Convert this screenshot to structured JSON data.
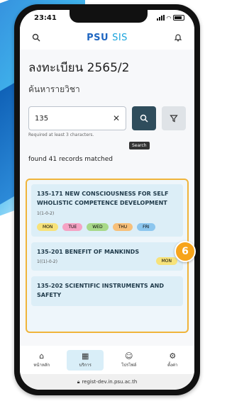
{
  "status": {
    "time": "23:41"
  },
  "header": {
    "logo_main": "PSU",
    "logo_sub": "SIS"
  },
  "page": {
    "title": "ลงทะเบียน 2565/2",
    "subtitle": "ค้นหารายวิชา"
  },
  "search": {
    "value": "135",
    "hint": "Required at least 3 characters.",
    "tooltip": "Search"
  },
  "results": {
    "found_text": "found 41 records matched",
    "items": [
      {
        "title": "135-171 NEW CONSCIOUSNESS FOR SELF WHOLISTIC COMPETENCE DEVELOPMENT",
        "credit": "1(1-0-2)",
        "days": [
          "MON",
          "TUE",
          "WED",
          "THU",
          "FRI"
        ]
      },
      {
        "title": "135-201 BENEFIT OF MANKINDS",
        "credit": "1((1)-0-2)",
        "days": [
          "MON"
        ]
      },
      {
        "title": "135-202 SCIENTIFIC INSTRUMENTS AND SAFETY",
        "credit": "",
        "days": []
      }
    ]
  },
  "annotation": {
    "badge": "6"
  },
  "nav": {
    "items": [
      {
        "label": "หน้าหลัก",
        "icon": "home-icon"
      },
      {
        "label": "บริการ",
        "icon": "grid-icon"
      },
      {
        "label": "โปรไฟล์",
        "icon": "profile-icon"
      },
      {
        "label": "ตั้งค่า",
        "icon": "gear-icon"
      }
    ]
  },
  "browser": {
    "url": "regist-dev.in.psu.ac.th"
  },
  "colors": {
    "accent": "#2f4d5c",
    "highlight_border": "#f0b43a",
    "badge": "#f7a41b",
    "day_mon": "#f7e27a",
    "day_tue": "#f5a3c4",
    "day_wed": "#a8d98a",
    "day_thu": "#f7c07a",
    "day_fri": "#8cc6ee"
  }
}
